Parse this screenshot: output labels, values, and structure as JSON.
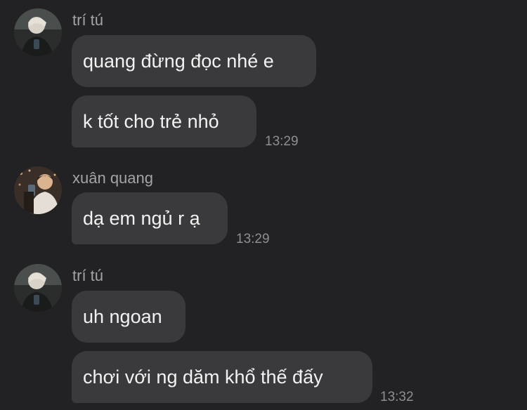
{
  "groups": [
    {
      "sender": "trí tú",
      "messages": [
        {
          "text": "quang đừng đọc nhé e"
        },
        {
          "text": "k tốt cho trẻ nhỏ",
          "time": "13:29"
        }
      ]
    },
    {
      "sender": "xuân quang",
      "messages": [
        {
          "text": "dạ em ngủ r ạ",
          "time": "13:29"
        }
      ]
    },
    {
      "sender": "trí tú",
      "messages": [
        {
          "text": "uh ngoan"
        },
        {
          "text": "chơi với ng dăm khổ thế đấy",
          "time": "13:32"
        }
      ]
    }
  ]
}
